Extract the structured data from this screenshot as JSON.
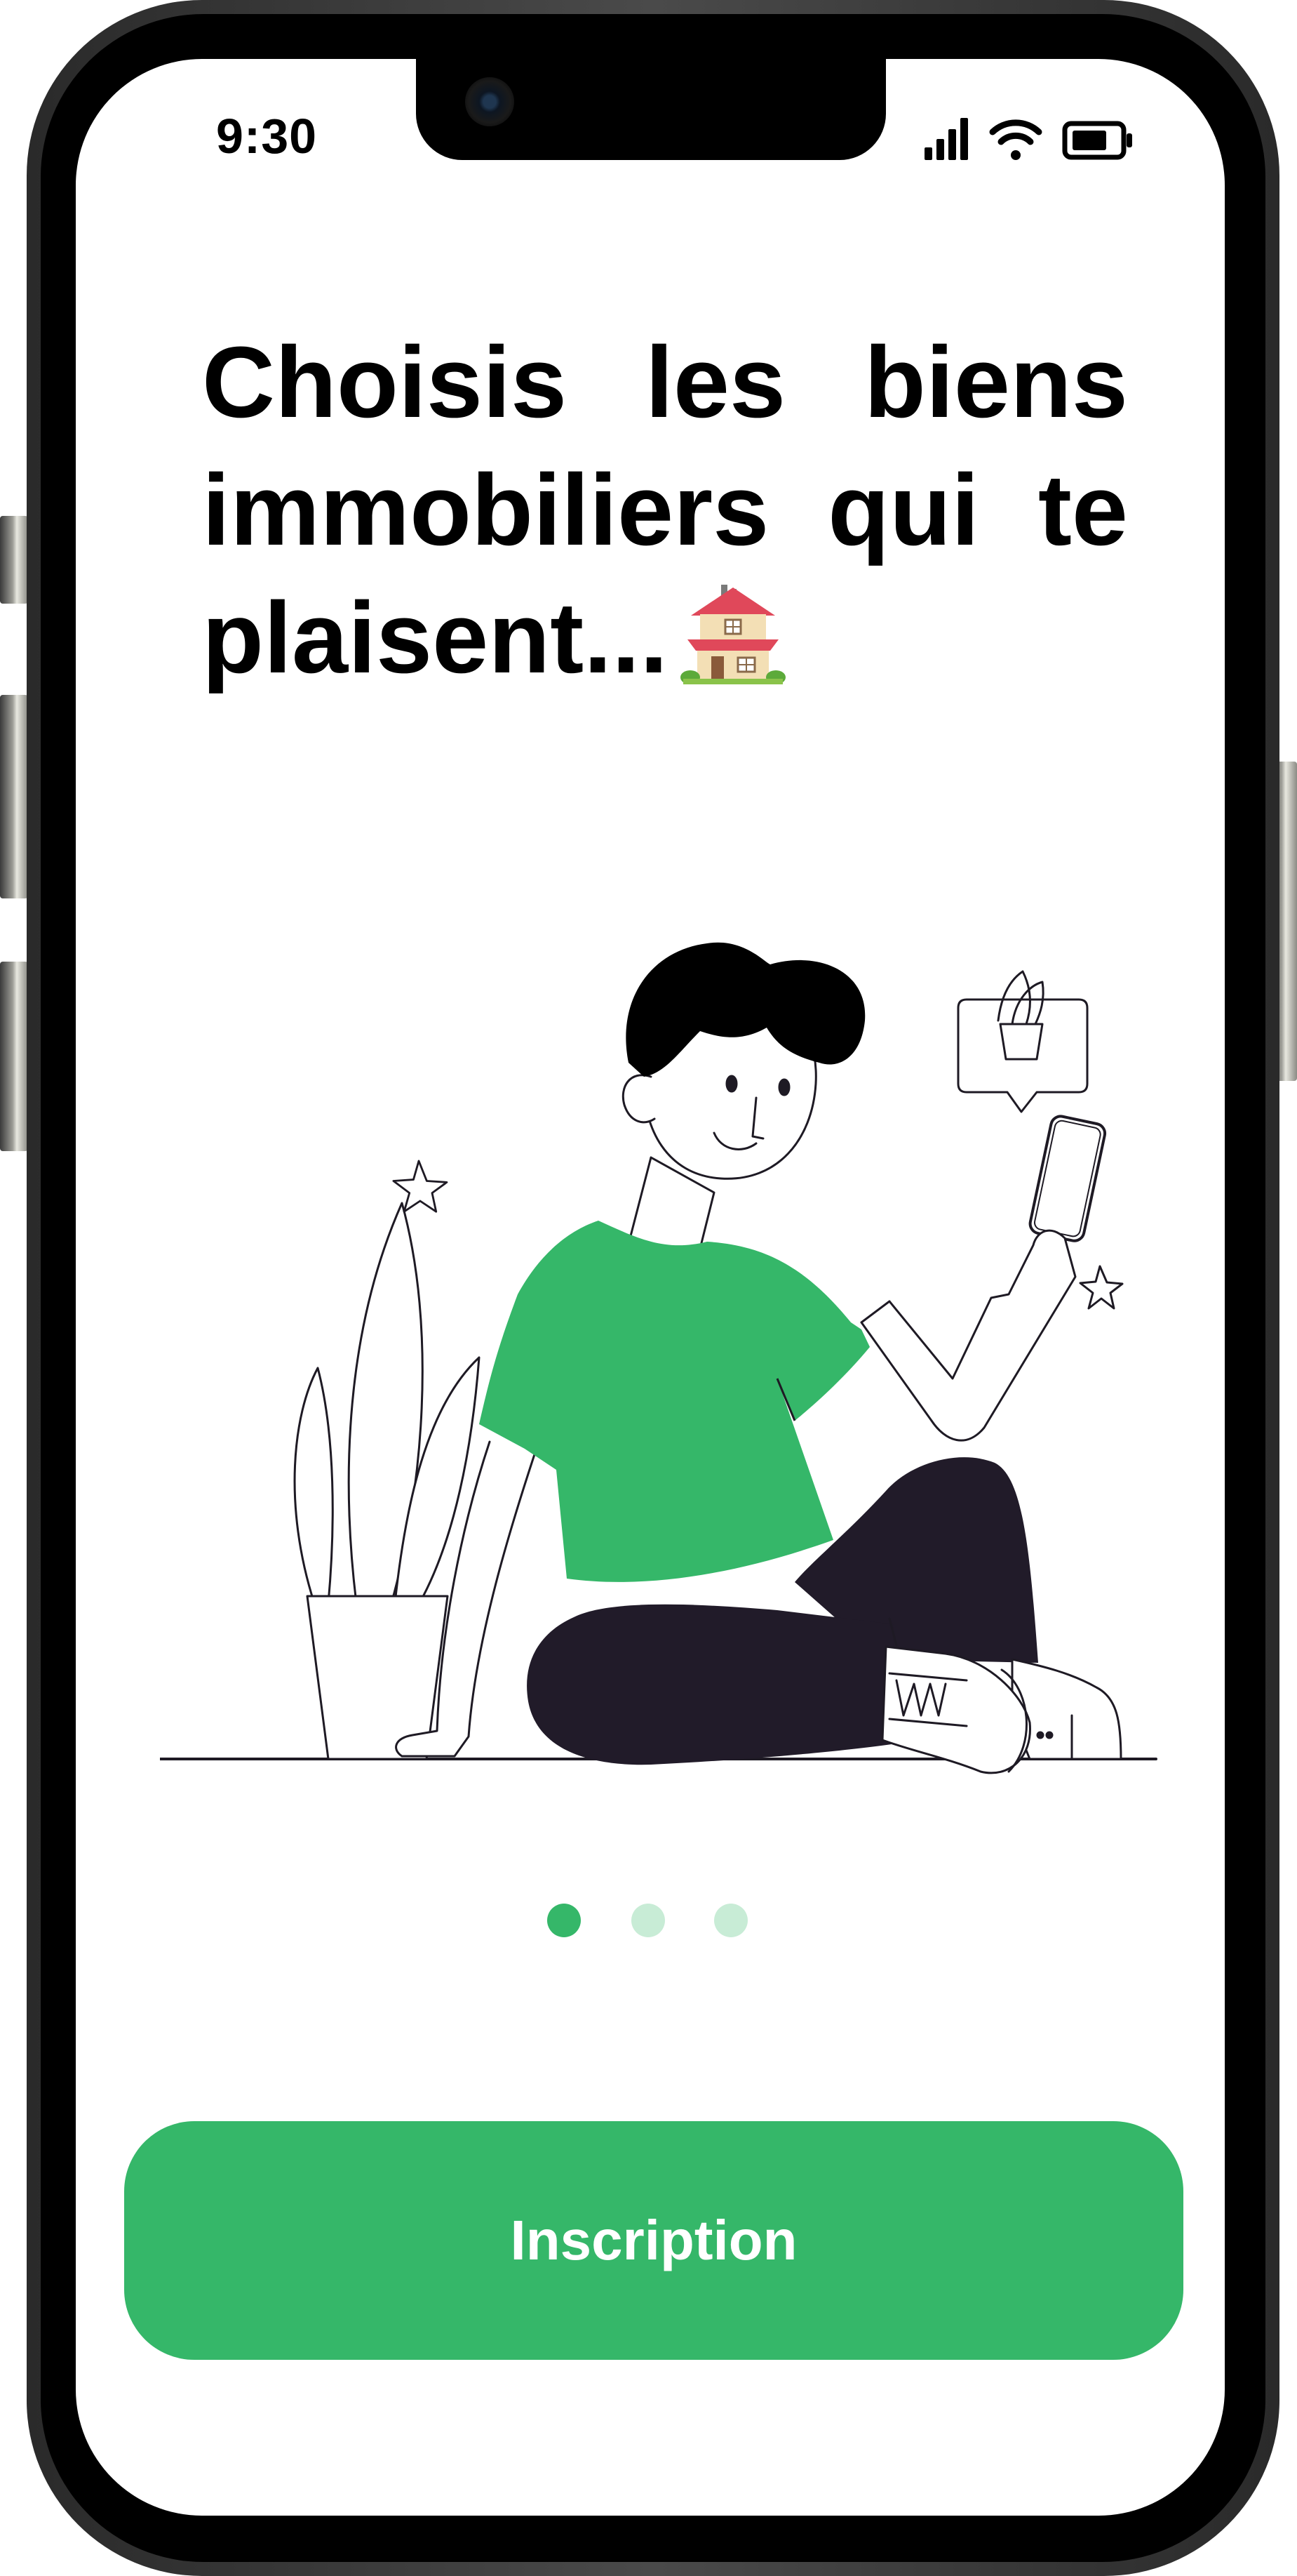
{
  "status_bar": {
    "time": "9:30",
    "icons": [
      "signal-icon",
      "wifi-icon",
      "battery-icon"
    ]
  },
  "onboarding": {
    "title": "Choisis les biens immobiliers qui te plaisent...",
    "title_emoji": "house-icon"
  },
  "pagination": {
    "total": 3,
    "active_index": 0
  },
  "cta": {
    "label": "Inscription"
  },
  "colors": {
    "accent": "#35B769",
    "dot_inactive": "#C8ECD6",
    "text": "#000000",
    "pants": "#211B29"
  }
}
